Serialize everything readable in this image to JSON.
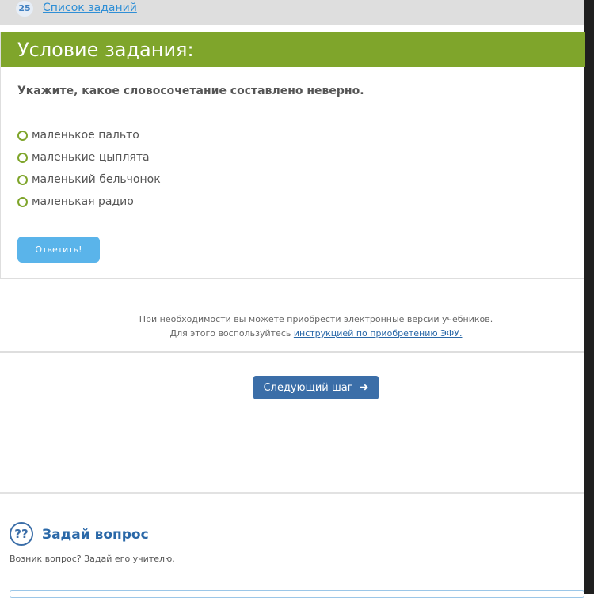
{
  "nav": {
    "step_number": "25",
    "task_list_label": "Список заданий"
  },
  "task": {
    "title": "Условие задания:",
    "question": "Укажите, какое словосочетание составлено неверно.",
    "options": [
      {
        "label": "маленькое пальто"
      },
      {
        "label": "маленькие цыплята"
      },
      {
        "label": "маленький бельчонок"
      },
      {
        "label": "маленькая радио"
      }
    ],
    "answer_button": "Ответить!"
  },
  "info": {
    "line1": "При необходимости вы можете приобрести электронные версии учебников.",
    "line2_prefix": "Для этого воспользуйтесь ",
    "line2_link": "инструкцией по приобретению ЭФУ."
  },
  "next_button": "Следующий шаг",
  "ask": {
    "icon_glyph": "??",
    "title": "Задай вопрос",
    "subtitle": "Возник вопрос? Задай его учителю."
  },
  "colors": {
    "header_green": "#7fa52b",
    "answer_blue": "#5ab4ea",
    "next_blue": "#3b6ea8",
    "link_blue": "#2f8fd6"
  },
  "icons": {
    "next_arrow": "arrow-right-icon",
    "ask": "question-circle-icon",
    "radio": "radio-circle-icon"
  }
}
